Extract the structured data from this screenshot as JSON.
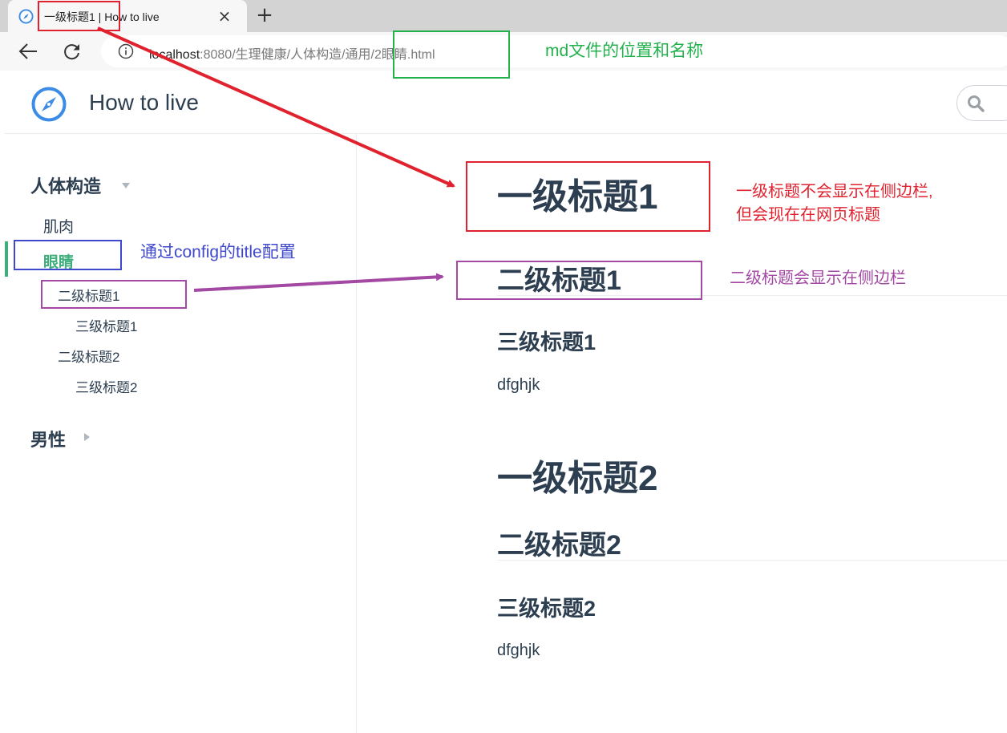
{
  "browser": {
    "tab_title": "一级标题1 | How to live",
    "close_glyph": "×",
    "newtab_glyph": "+",
    "url_host": "localhost",
    "url_rest": ":8080/生理健康/人体构造/通用/2眼睛.html",
    "icons": [
      "compass-icon",
      "close-icon",
      "plus-icon",
      "back-arrow-icon",
      "reload-icon",
      "info-icon"
    ]
  },
  "site": {
    "title": "How to live",
    "logo": "compass-logo-icon",
    "search_icon": "search-icon"
  },
  "sidebar": {
    "group1": "人体构造",
    "item_muscle": "肌肉",
    "item_eye": "眼睛",
    "sub_h2_1": "二级标题1",
    "sub_h3_1": "三级标题1",
    "sub_h2_2": "二级标题2",
    "sub_h3_2": "三级标题2",
    "group2": "男性",
    "accent_color": "#3eaf7c"
  },
  "content": {
    "h1_a": "一级标题1",
    "h2_a": "二级标题1",
    "h3_a": "三级标题1",
    "p_a": "dfghjk",
    "h1_b": "一级标题2",
    "h2_b": "二级标题2",
    "h3_b": "三级标题2",
    "p_b": "dfghjk"
  },
  "annotations": {
    "md_file": "md文件的位置和名称",
    "config_title": "通过config的title配置",
    "h1_note_line1": "一级标题不会显示在侧边栏,",
    "h1_note_line2": "但会现在在网页标题",
    "h2_note": "二级标题会显示在侧边栏",
    "colors": {
      "red": "#e0222e",
      "green": "#22b14c",
      "blue": "#3f48cc",
      "purple": "#a349a4"
    }
  }
}
